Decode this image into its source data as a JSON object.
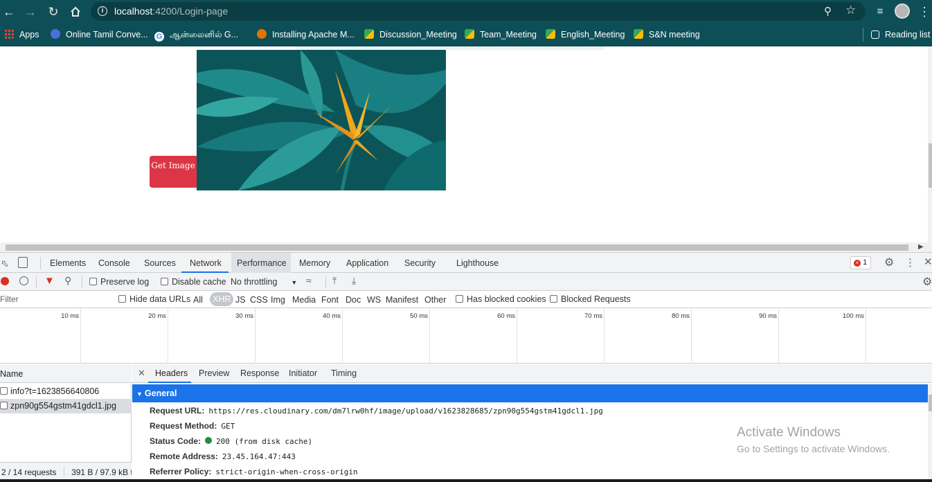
{
  "browser": {
    "url_host": "localhost",
    "url_path": ":4200/Login-page",
    "bookmarks": [
      {
        "label": "Apps",
        "color": "#e94235"
      },
      {
        "label": "Online Tamil Conve...",
        "color": "#4a6fd8"
      },
      {
        "label": "ஆன்லைனில் G...",
        "color": "#ffffff"
      },
      {
        "label": "Installing Apache M...",
        "color": "#e37400"
      },
      {
        "label": "Discussion_Meeting",
        "color": "#34a853"
      },
      {
        "label": "Team_Meeting",
        "color": "#34a853"
      },
      {
        "label": "English_Meeting",
        "color": "#34a853"
      },
      {
        "label": "S&N meeting",
        "color": "#34a853"
      }
    ],
    "reading_list": "Reading list"
  },
  "page": {
    "get_image_button": "Get Image"
  },
  "devtools": {
    "tabs": [
      "Elements",
      "Console",
      "Sources",
      "Network",
      "Performance",
      "Memory",
      "Application",
      "Security",
      "Lighthouse"
    ],
    "active_tab": "Network",
    "error_count": "1",
    "toolbar": {
      "preserve_log": "Preserve log",
      "disable_cache": "Disable cache",
      "throttling": "No throttling"
    },
    "filter": {
      "placeholder": "Filter",
      "hide_data_urls": "Hide data URLs",
      "types": [
        "All",
        "XHR",
        "JS",
        "CSS",
        "Img",
        "Media",
        "Font",
        "Doc",
        "WS",
        "Manifest",
        "Other"
      ],
      "active_type": "XHR",
      "has_blocked_cookies": "Has blocked cookies",
      "blocked_requests": "Blocked Requests"
    },
    "timeline_labels": [
      "10 ms",
      "20 ms",
      "30 ms",
      "40 ms",
      "50 ms",
      "60 ms",
      "70 ms",
      "80 ms",
      "90 ms",
      "100 ms"
    ],
    "requests": {
      "header": "Name",
      "rows": [
        "info?t=1623856640806",
        "zpn90g554gstm41gdcl1.jpg"
      ],
      "status_count": "2 / 14 requests",
      "status_size": "391 B / 97.9 kB t"
    },
    "detail": {
      "tabs": [
        "Headers",
        "Preview",
        "Response",
        "Initiator",
        "Timing"
      ],
      "active_tab": "Headers",
      "section": "General",
      "rows": [
        {
          "key": "Request URL:",
          "value": "https://res.cloudinary.com/dm7lrw0hf/image/upload/v1623828685/zpn90g554gstm41gdcl1.jpg"
        },
        {
          "key": "Request Method:",
          "value": "GET"
        },
        {
          "key": "Status Code:",
          "value": "200  (from disk cache)"
        },
        {
          "key": "Remote Address:",
          "value": "23.45.164.47:443"
        },
        {
          "key": "Referrer Policy:",
          "value": "strict-origin-when-cross-origin"
        }
      ]
    }
  },
  "watermark": {
    "line1": "Activate Windows",
    "line2": "Go to Settings to activate Windows."
  }
}
